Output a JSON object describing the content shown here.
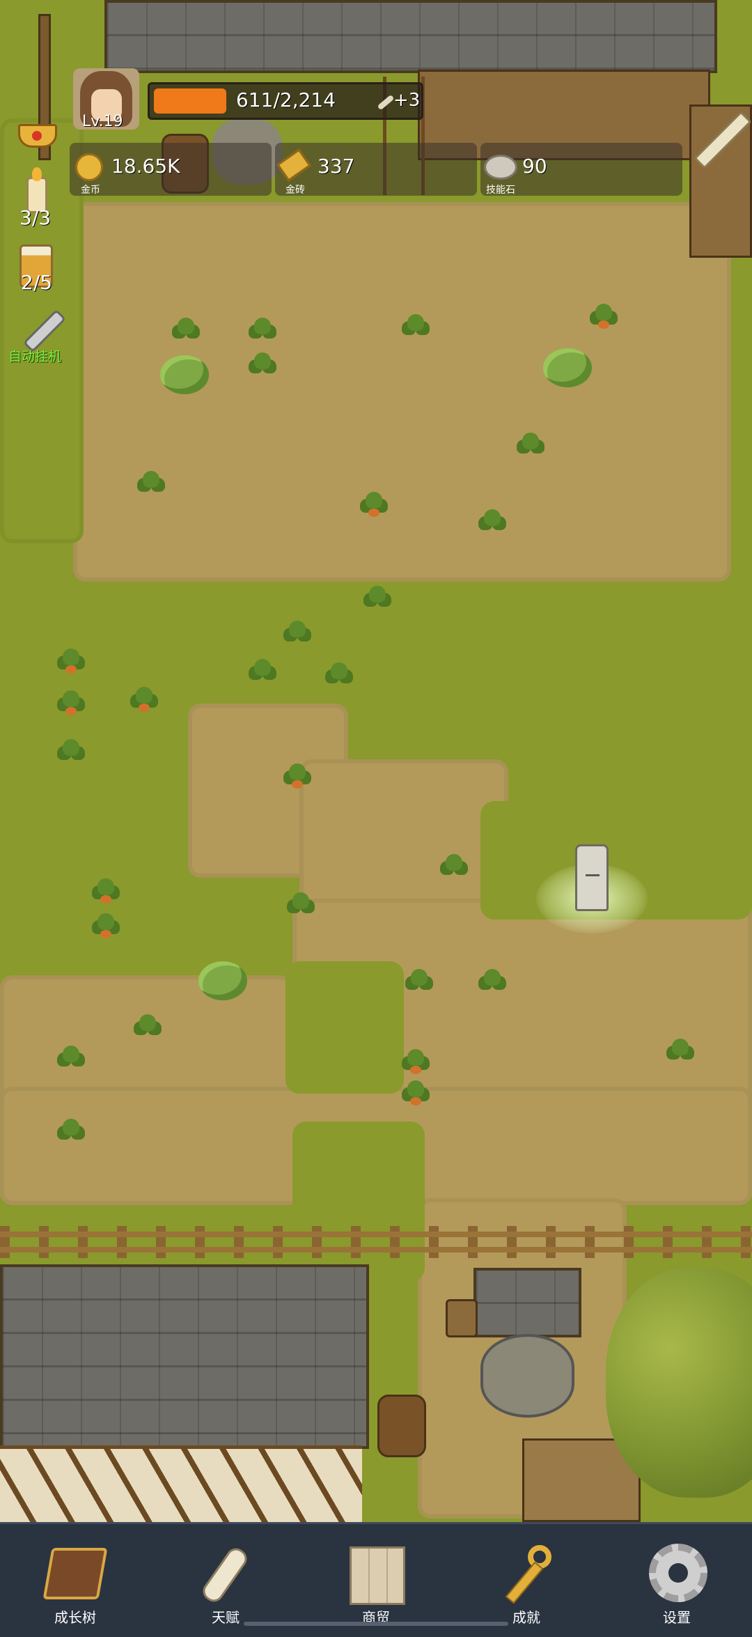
{
  "player": {
    "level": "Lv.19",
    "xp_text": "611/2,214",
    "xp_fraction": 0.276,
    "bonus": "+3"
  },
  "currencies": {
    "gold": {
      "value": "18.65K",
      "label": "金币"
    },
    "gold_bar": {
      "value": "337",
      "label": "金砖"
    },
    "skill_stone": {
      "value": "90",
      "label": "技能石"
    }
  },
  "side_buttons": {
    "candle_count": "3/3",
    "drink_count": "2/5",
    "auto_idle": "自动挂机"
  },
  "nav": {
    "items": [
      {
        "label": "成长树",
        "icon": "book-icon"
      },
      {
        "label": "天赋",
        "icon": "scroll-icon"
      },
      {
        "label": "商贸",
        "icon": "map-icon"
      },
      {
        "label": "成就",
        "icon": "key-icon"
      },
      {
        "label": "设置",
        "icon": "gear-icon"
      }
    ]
  },
  "colors": {
    "grass": "#8a9a2c",
    "dirt": "#b39a5a",
    "xp_bar": "#f07a1a",
    "nav_bg": "#2a3340"
  }
}
